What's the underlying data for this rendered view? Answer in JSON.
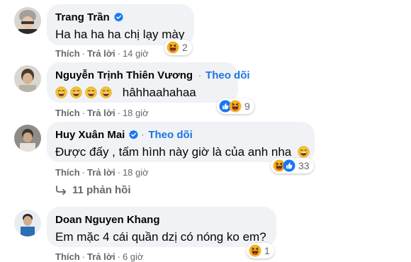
{
  "comments": [
    {
      "name": "Trang Trần",
      "verified": true,
      "text": "Ha ha ha ha chị lạy mày",
      "reactions": [
        "haha-icon"
      ],
      "reaction_count": "2",
      "like_label": "Thích",
      "reply_label": "Trả lời",
      "time": "14 giờ"
    },
    {
      "name": "Nguyễn Trịnh Thiên Vương",
      "verified": true,
      "follow_label": "Theo dõi",
      "text": "hâhhaahahaa",
      "leading_emojis": [
        "laughing-emoji",
        "laughing-emoji",
        "laughing-emoji",
        "laughing-emoji"
      ],
      "reactions": [
        "like-icon",
        "haha-icon"
      ],
      "reaction_count": "9",
      "like_label": "Thích",
      "reply_label": "Trả lời",
      "time": "18 giờ"
    },
    {
      "name": "Huy Xuân Mai",
      "verified": true,
      "follow_label": "Theo dõi",
      "text": "Được đấy , tấm hình này giờ là của anh nha",
      "trailing_emoji": "laughing-emoji",
      "reactions": [
        "haha-icon",
        "like-icon"
      ],
      "reaction_count": "33",
      "like_label": "Thích",
      "reply_label": "Trả lời",
      "time": "18 giờ"
    },
    {
      "name": "Doan Nguyen Khang",
      "verified": false,
      "text": "Em mặc 4 cái quần dzị có nóng ko em?",
      "reactions": [
        "haha-icon"
      ],
      "reaction_count": "1",
      "like_label": "Thích",
      "reply_label": "Trả lời",
      "time": "6 giờ"
    }
  ],
  "replies_link": "11 phản hồi",
  "colors": {
    "accent": "#1b74e4",
    "bubble": "#f0f2f5",
    "muted": "#65676b",
    "haha": "#f7b125"
  }
}
